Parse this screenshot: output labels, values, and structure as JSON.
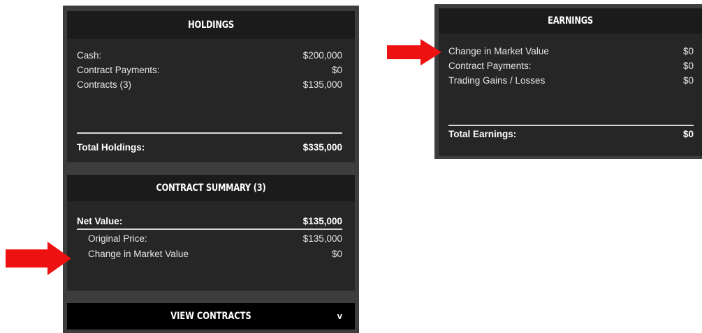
{
  "holdings": {
    "title": "HOLDINGS",
    "rows": [
      {
        "label": "Cash:",
        "value": "$200,000"
      },
      {
        "label": "Contract Payments:",
        "value": "$0"
      },
      {
        "label": "Contracts (3)",
        "value": "$135,000"
      }
    ],
    "total_label": "Total Holdings:",
    "total_value": "$335,000"
  },
  "contract_summary": {
    "title": "CONTRACT SUMMARY (3)",
    "net_label": "Net Value:",
    "net_value": "$135,000",
    "rows": [
      {
        "label": "Original Price:",
        "value": "$135,000"
      },
      {
        "label": "Change in Market Value",
        "value": "$0"
      }
    ],
    "view_button": "VIEW CONTRACTS",
    "view_chevron": "v"
  },
  "earnings": {
    "title": "EARNINGS",
    "rows": [
      {
        "label": "Change in Market Value",
        "value": "$0"
      },
      {
        "label": "Contract Payments:",
        "value": "$0"
      },
      {
        "label": "Trading Gains / Losses",
        "value": "$0"
      }
    ],
    "total_label": "Total Earnings:",
    "total_value": "$0"
  },
  "colors": {
    "arrow": "#ee1111",
    "panel_bg": "#262626",
    "header_bg": "#1b1b1b"
  }
}
